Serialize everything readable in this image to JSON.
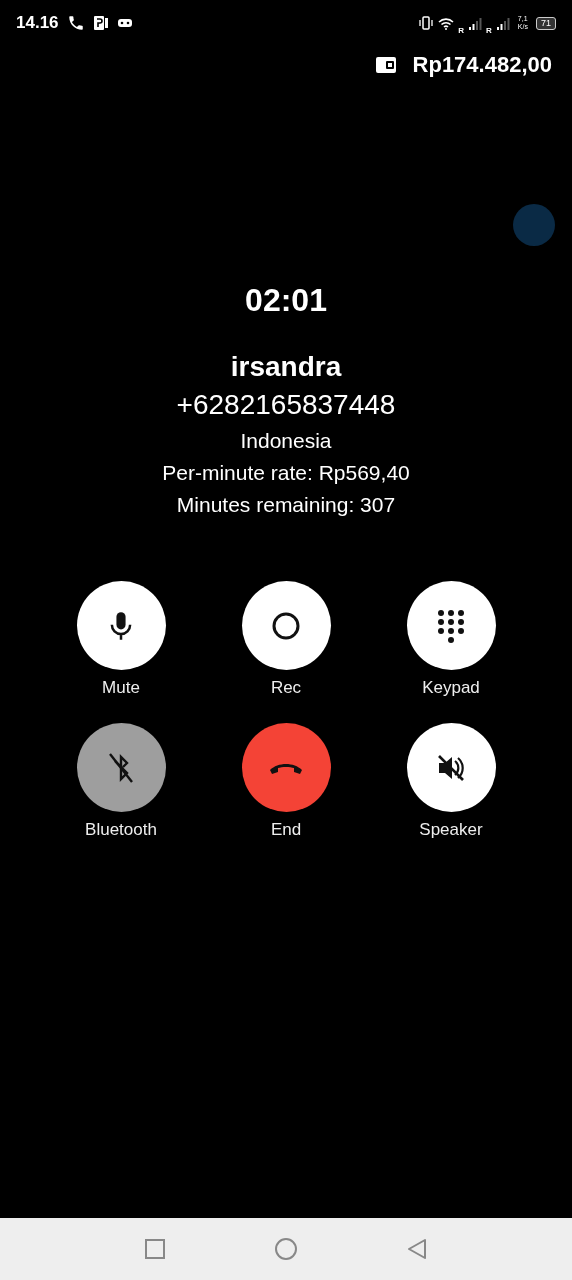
{
  "status_bar": {
    "time": "14.16",
    "roaming": [
      "R",
      "R"
    ],
    "speed": "7,1",
    "speed_unit": "K/s",
    "battery": "71"
  },
  "balance": "Rp174.482,00",
  "call": {
    "duration": "02:01",
    "name": "irsandra",
    "number": "+6282165837448",
    "country": "Indonesia",
    "rate": "Per-minute rate: Rp569,40",
    "remaining": "Minutes remaining: 307"
  },
  "controls": [
    {
      "kind": "mute",
      "label": "Mute",
      "disabled": false
    },
    {
      "kind": "rec",
      "label": "Rec",
      "disabled": false
    },
    {
      "kind": "keypad",
      "label": "Keypad",
      "disabled": false
    },
    {
      "kind": "bluetooth",
      "label": "Bluetooth",
      "disabled": true
    },
    {
      "kind": "end",
      "label": "End",
      "disabled": false
    },
    {
      "kind": "speaker",
      "label": "Speaker",
      "disabled": false
    }
  ]
}
